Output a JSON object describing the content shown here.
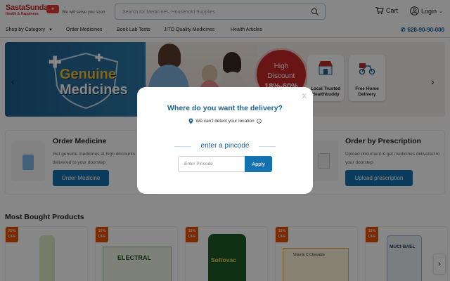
{
  "header": {
    "logo_main": "SastaSundar",
    "logo_sub": "Health & Happiness",
    "tagline": "We will serve you soon",
    "search_placeholder": "Search for Medicines, Household Supplies",
    "cart_label": "Cart",
    "login_label": "Login"
  },
  "nav": {
    "items": [
      "Shop by Category",
      "Order Medicines",
      "Book Lab Tests",
      "JITO Quality Medicines",
      "Health Articles"
    ],
    "phone": "628-90-90-000"
  },
  "banner": {
    "title_line1": "Genuine",
    "title_line2": "Medicines",
    "discount_l1": "High",
    "discount_l2": "Discount",
    "discount_l3": "18%-60%",
    "features": [
      "Local Trusted Healthbuddy",
      "Free Home Delivery"
    ]
  },
  "cards": {
    "order": {
      "title": "Order Medicine",
      "desc": "Get genuine medicines at high discounts delivered to your doorstep",
      "button": "Order Medicine"
    },
    "prescription": {
      "title": "Order by Prescription",
      "desc": "Upload document & get medicines delivered to your doorstep",
      "button": "Upload prescription"
    }
  },
  "products": {
    "title": "Most Bought Products",
    "items": [
      {
        "off": "20% OFF",
        "name": ""
      },
      {
        "off": "16% OFF",
        "name": "ELECTRAL"
      },
      {
        "off": "18% OFF",
        "name": "Softovac"
      },
      {
        "off": "18% OFF",
        "name": "Vitamin C Chewable"
      },
      {
        "off": "18% OFF",
        "name": "MUCI-BAEL"
      }
    ]
  },
  "modal": {
    "title": "Where do you want the delivery?",
    "location_msg": "We can't detect your location",
    "subtitle": "enter a pincode",
    "pincode_placeholder": "Enter Pincode",
    "apply_label": "Apply",
    "close_label": "X"
  },
  "colors": {
    "brand_blue": "#1572b0",
    "brand_red": "#c62828",
    "offer_orange": "#e65100"
  }
}
